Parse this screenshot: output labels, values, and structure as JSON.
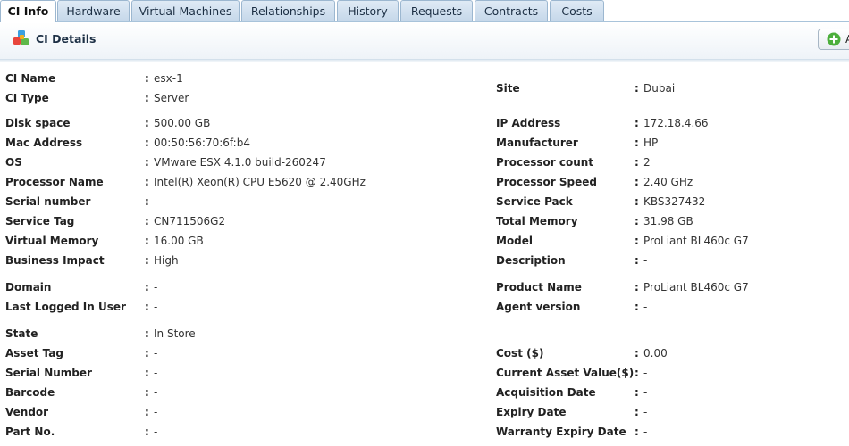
{
  "tabs": [
    {
      "label": "CI Info",
      "active": true
    },
    {
      "label": "Hardware",
      "active": false
    },
    {
      "label": "Virtual Machines",
      "active": false
    },
    {
      "label": "Relationships",
      "active": false
    },
    {
      "label": "History",
      "active": false
    },
    {
      "label": "Requests",
      "active": false
    },
    {
      "label": "Contracts",
      "active": false
    },
    {
      "label": "Costs",
      "active": false
    }
  ],
  "header": {
    "title": "CI Details",
    "add_label": "A"
  },
  "separator": ":",
  "left_fields": [
    {
      "label": "CI Name",
      "value": "esx-1"
    },
    {
      "label": "CI Type",
      "value": "Server"
    },
    {
      "label": "Disk space",
      "value": "500.00 GB"
    },
    {
      "label": "Mac Address",
      "value": "00:50:56:70:6f:b4"
    },
    {
      "label": "OS",
      "value": "VMware ESX 4.1.0 build-260247"
    },
    {
      "label": "Processor Name",
      "value": "Intel(R) Xeon(R) CPU E5620 @ 2.40GHz"
    },
    {
      "label": "Serial number",
      "value": "-"
    },
    {
      "label": "Service Tag",
      "value": "CN711506G2"
    },
    {
      "label": "Virtual Memory",
      "value": "16.00 GB"
    },
    {
      "label": "Business Impact",
      "value": "High"
    },
    {
      "label": "Domain",
      "value": "-"
    },
    {
      "label": "Last Logged In User",
      "value": "-"
    },
    {
      "label": "State",
      "value": "In Store"
    },
    {
      "label": "Asset Tag",
      "value": "-"
    },
    {
      "label": "Serial Number",
      "value": "-"
    },
    {
      "label": "Barcode",
      "value": "-"
    },
    {
      "label": "Vendor",
      "value": "-"
    },
    {
      "label": "Part No.",
      "value": "-"
    }
  ],
  "right_fields": [
    {
      "label": "Site",
      "value": "Dubai"
    },
    {
      "label": "IP Address",
      "value": "172.18.4.66"
    },
    {
      "label": "Manufacturer",
      "value": "HP"
    },
    {
      "label": "Processor count",
      "value": "2"
    },
    {
      "label": "Processor Speed",
      "value": "2.40 GHz"
    },
    {
      "label": "Service Pack",
      "value": "KBS327432"
    },
    {
      "label": "Total Memory",
      "value": "31.98 GB"
    },
    {
      "label": "Model",
      "value": "ProLiant BL460c G7"
    },
    {
      "label": "Description",
      "value": "-"
    },
    {
      "label": "Product Name",
      "value": "ProLiant BL460c G7"
    },
    {
      "label": "Agent version",
      "value": "-"
    },
    {
      "label": "Cost ($)",
      "value": "0.00"
    },
    {
      "label": "Current Asset Value($)",
      "value": "-"
    },
    {
      "label": "Acquisition Date",
      "value": "-"
    },
    {
      "label": "Expiry Date",
      "value": "-"
    },
    {
      "label": "Warranty Expiry Date",
      "value": "-"
    }
  ]
}
